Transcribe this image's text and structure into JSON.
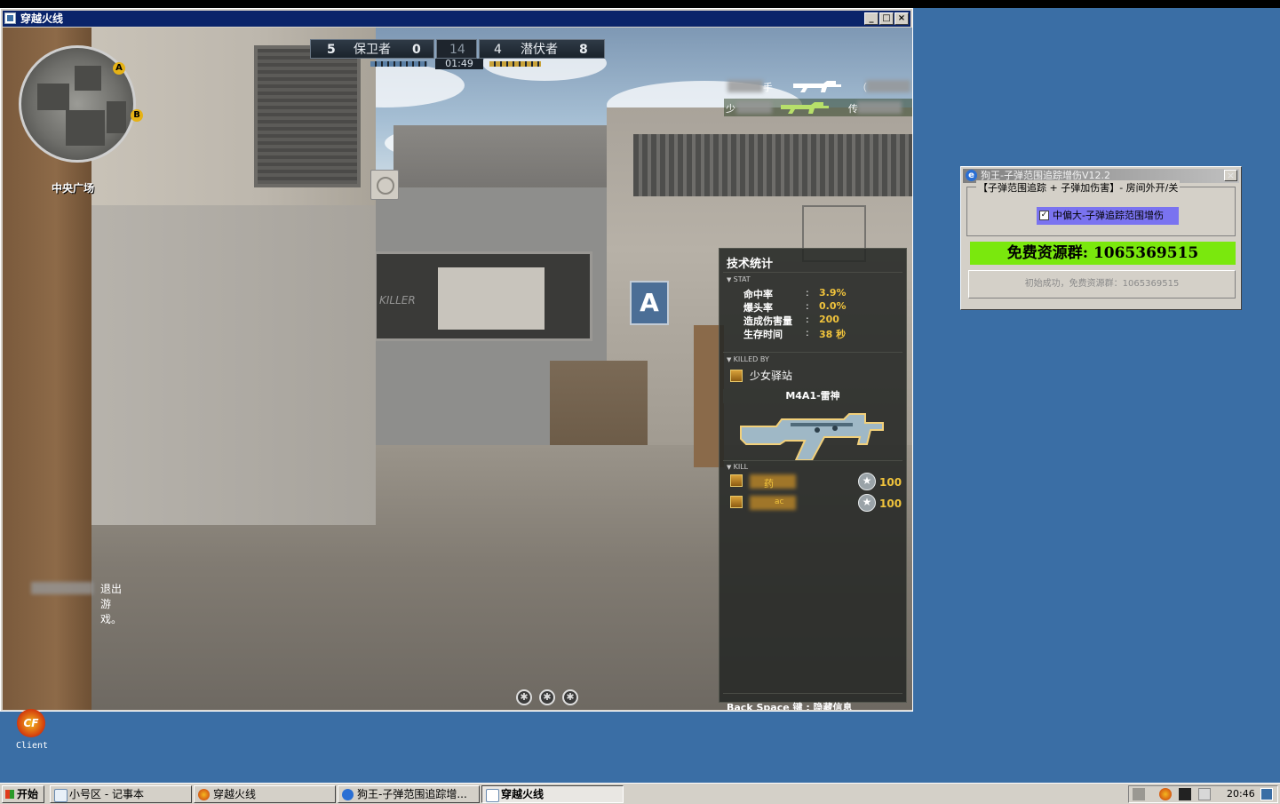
{
  "window": {
    "title": "穿越火线",
    "btn_min": "_",
    "btn_max": "□",
    "btn_close": "×"
  },
  "hud": {
    "team_left_score": "5",
    "team_left_name": "保卫者",
    "team_left_alive": "0",
    "round_target": "14",
    "team_right_alive": "4",
    "team_right_name": "潜伏者",
    "team_right_score": "8",
    "timer": "01:49",
    "minimap_marker_a": "A",
    "minimap_marker_b": "B",
    "map_location": "中央广场",
    "killfeed": [
      {
        "left": "手",
        "right": "（"
      },
      {
        "left": "少",
        "right": "传"
      }
    ],
    "killer_tag": "KILLER",
    "sign_letter": "A",
    "chat_message": "退出游戏。"
  },
  "stats": {
    "title": "技术统计",
    "stat_section": "STAT",
    "rows": [
      {
        "label": "命中率",
        "value": "3.9%"
      },
      {
        "label": "爆头率",
        "value": "0.0%"
      },
      {
        "label": "造成伤害量",
        "value": "200"
      },
      {
        "label": "生存时间",
        "value": "38 秒"
      }
    ],
    "killed_by_section": "KILLED BY",
    "killer_name": "少女驿站",
    "weapon_name": "M4A1-雷神",
    "kill_section": "KILL",
    "kills": [
      {
        "name": "药",
        "score": "100"
      },
      {
        "name": "ac",
        "score": "100"
      }
    ],
    "footer": "Back Space 键 : 隐藏信息"
  },
  "cheat": {
    "title": "狗王-子弹范围追踪增伤V12.2",
    "close": "×",
    "group_label": "【子弹范围追踪 + 子弹加伤害】- 房间外开/关",
    "checkbox_label": "中偏大-子弹追踪范围增伤",
    "checkbox_mark": "✓",
    "banner": "免费资源群: 1065369515",
    "status": "初始成功，免费资源群：1065369515"
  },
  "desktop": {
    "icon_label": "Client",
    "icon_glyph": "CF"
  },
  "taskbar": {
    "start": "开始",
    "items": [
      {
        "label": "小号区 - 记事本"
      },
      {
        "label": "穿越火线"
      },
      {
        "label": "狗王-子弹范围追踪增..."
      },
      {
        "label": "穿越火线"
      }
    ],
    "clock": "20:46"
  }
}
